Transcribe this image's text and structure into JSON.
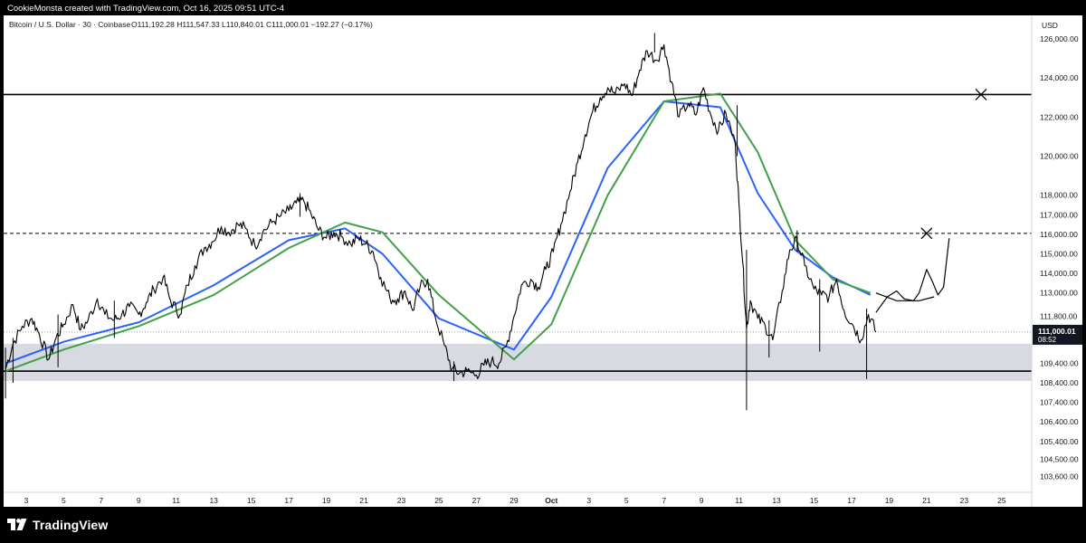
{
  "header": {
    "attribution": "CookieMonsta created with TradingView.com, Oct 16, 2025 09:51 UTC-4"
  },
  "footer": {
    "brand": "TradingView",
    "logo_icon": "tradingview-logo-icon"
  },
  "chart_data": {
    "type": "candlestick",
    "title": "Bitcoin / U.S. Dollar · 30 · Coinbase",
    "ohlc_text": "O111,192.28 H111,547.33 L110,840.01 C111,000.01 −192.27 (−0.17%)",
    "currency_label": "USD",
    "ylim": [
      102800,
      127200
    ],
    "y_axis_labels": [
      "126,000.00",
      "124,000.00",
      "122,000.00",
      "120,000.00",
      "118,000.00",
      "117,000.00",
      "116,000.00",
      "115,000.00",
      "114,000.00",
      "113,000.00",
      "111,800.00",
      "109,400.00",
      "108,400.00",
      "107,400.00",
      "106,400.00",
      "105,400.00",
      "104,500.00",
      "103,600.00"
    ],
    "y_axis_values": [
      126000,
      124000,
      122000,
      120000,
      118000,
      117000,
      116000,
      115000,
      114000,
      113000,
      111800,
      109400,
      108400,
      107400,
      106400,
      105400,
      104500,
      103600
    ],
    "x_axis_labels": [
      "3",
      "5",
      "7",
      "9",
      "11",
      "13",
      "15",
      "17",
      "19",
      "21",
      "23",
      "25",
      "27",
      "29",
      "Oct",
      "3",
      "5",
      "7",
      "9",
      "11",
      "13",
      "15",
      "17",
      "19",
      "21",
      "23",
      "25"
    ],
    "x_axis_days": [
      3,
      5,
      7,
      9,
      11,
      13,
      15,
      17,
      19,
      21,
      23,
      25,
      27,
      29,
      31,
      33,
      35,
      37,
      39,
      41,
      43,
      45,
      47,
      49,
      51,
      53,
      55
    ],
    "x_range_days": [
      1.8,
      56.6
    ],
    "price_line": {
      "value": 111000.01,
      "label": "111,000.01",
      "countdown": "08:52",
      "color": "#131722"
    },
    "price_path": [
      [
        1.9,
        109100
      ],
      [
        2.3,
        110400
      ],
      [
        2.8,
        111300
      ],
      [
        3.3,
        111700
      ],
      [
        3.7,
        110900
      ],
      [
        4.2,
        109600
      ],
      [
        4.6,
        110700
      ],
      [
        5.0,
        111400
      ],
      [
        5.5,
        112400
      ],
      [
        5.9,
        111100
      ],
      [
        6.3,
        111600
      ],
      [
        6.8,
        112700
      ],
      [
        7.2,
        111900
      ],
      [
        7.7,
        111600
      ],
      [
        8.1,
        111900
      ],
      [
        8.5,
        112300
      ],
      [
        9.0,
        111900
      ],
      [
        9.4,
        112500
      ],
      [
        9.8,
        113200
      ],
      [
        10.3,
        113800
      ],
      [
        10.7,
        112600
      ],
      [
        11.2,
        111900
      ],
      [
        11.6,
        113400
      ],
      [
        12.0,
        114400
      ],
      [
        12.5,
        115300
      ],
      [
        12.9,
        115600
      ],
      [
        13.4,
        116400
      ],
      [
        13.8,
        116100
      ],
      [
        14.3,
        116500
      ],
      [
        14.7,
        116300
      ],
      [
        15.2,
        115400
      ],
      [
        15.6,
        116100
      ],
      [
        16.1,
        116600
      ],
      [
        16.5,
        116900
      ],
      [
        17.0,
        117200
      ],
      [
        17.4,
        117600
      ],
      [
        17.8,
        117700
      ],
      [
        18.2,
        117000
      ],
      [
        18.6,
        116200
      ],
      [
        19.0,
        115800
      ],
      [
        19.4,
        116100
      ],
      [
        19.8,
        115900
      ],
      [
        20.3,
        115500
      ],
      [
        20.7,
        115800
      ],
      [
        21.1,
        115500
      ],
      [
        21.5,
        115100
      ],
      [
        21.9,
        113800
      ],
      [
        22.4,
        112700
      ],
      [
        22.8,
        112700
      ],
      [
        23.2,
        113100
      ],
      [
        23.6,
        112100
      ],
      [
        24.0,
        113300
      ],
      [
        24.4,
        113700
      ],
      [
        24.8,
        111800
      ],
      [
        25.3,
        110300
      ],
      [
        25.7,
        109100
      ],
      [
        26.1,
        108900
      ],
      [
        26.5,
        109000
      ],
      [
        27.0,
        108800
      ],
      [
        27.4,
        109300
      ],
      [
        27.8,
        109500
      ],
      [
        28.2,
        109400
      ],
      [
        28.6,
        110300
      ],
      [
        29.0,
        111800
      ],
      [
        29.4,
        113400
      ],
      [
        29.9,
        113700
      ],
      [
        30.3,
        113300
      ],
      [
        30.7,
        114200
      ],
      [
        31.1,
        115100
      ],
      [
        31.5,
        116500
      ],
      [
        32.0,
        118200
      ],
      [
        32.4,
        119700
      ],
      [
        32.8,
        121100
      ],
      [
        33.2,
        122300
      ],
      [
        33.6,
        123000
      ],
      [
        34.0,
        123500
      ],
      [
        34.4,
        123200
      ],
      [
        34.9,
        123700
      ],
      [
        35.3,
        123100
      ],
      [
        35.7,
        124400
      ],
      [
        36.1,
        125400
      ],
      [
        36.6,
        124900
      ],
      [
        37.0,
        125700
      ],
      [
        37.4,
        123800
      ],
      [
        37.8,
        122000
      ],
      [
        38.3,
        122700
      ],
      [
        38.7,
        122100
      ],
      [
        39.1,
        123500
      ],
      [
        39.5,
        122100
      ],
      [
        39.9,
        121300
      ],
      [
        40.3,
        122200
      ],
      [
        40.8,
        120600
      ],
      [
        41.0,
        117500
      ],
      [
        41.2,
        114500
      ],
      [
        41.4,
        111200
      ],
      [
        41.6,
        112600
      ],
      [
        42.0,
        111700
      ],
      [
        42.4,
        111300
      ],
      [
        42.8,
        110600
      ],
      [
        43.3,
        113100
      ],
      [
        43.7,
        115200
      ],
      [
        44.1,
        115700
      ],
      [
        44.5,
        114400
      ],
      [
        45.0,
        113200
      ],
      [
        45.4,
        112900
      ],
      [
        45.8,
        112800
      ],
      [
        46.2,
        113700
      ],
      [
        46.6,
        112100
      ],
      [
        47.1,
        111300
      ],
      [
        47.5,
        110600
      ],
      [
        47.9,
        111900
      ],
      [
        48.3,
        111000
      ]
    ],
    "wicks": [
      {
        "x": 1.9,
        "low": 107600,
        "high": 110200
      },
      {
        "x": 2.3,
        "low": 108400,
        "high": 110700
      },
      {
        "x": 4.7,
        "low": 109200,
        "high": 111900
      },
      {
        "x": 7.7,
        "low": 110700,
        "high": 112600
      },
      {
        "x": 17.6,
        "low": 116900,
        "high": 118100
      },
      {
        "x": 25.8,
        "low": 108500,
        "high": 109500
      },
      {
        "x": 36.5,
        "low": 125300,
        "high": 126300
      },
      {
        "x": 40.9,
        "low": 120000,
        "high": 122600
      },
      {
        "x": 41.4,
        "low": 107000,
        "high": 115200
      },
      {
        "x": 42.6,
        "low": 109700,
        "high": 111600
      },
      {
        "x": 44.1,
        "low": 115100,
        "high": 116200
      },
      {
        "x": 45.3,
        "low": 110000,
        "high": 113700
      },
      {
        "x": 47.8,
        "low": 108600,
        "high": 112200
      }
    ],
    "series": [
      {
        "name": "",
        "color": "#2962ff",
        "values": [
          [
            1.9,
            109400
          ],
          [
            5,
            110500
          ],
          [
            9,
            111500
          ],
          [
            13,
            113400
          ],
          [
            17,
            115700
          ],
          [
            20,
            116300
          ],
          [
            22,
            115000
          ],
          [
            25,
            111700
          ],
          [
            29,
            110100
          ],
          [
            31,
            112800
          ],
          [
            34,
            119400
          ],
          [
            37,
            122800
          ],
          [
            40,
            122500
          ],
          [
            42,
            118100
          ],
          [
            44,
            115200
          ],
          [
            46,
            113800
          ],
          [
            48,
            112900
          ]
        ]
      },
      {
        "name": "",
        "color": "#43a047",
        "values": [
          [
            1.9,
            109000
          ],
          [
            5,
            110100
          ],
          [
            9,
            111300
          ],
          [
            13,
            112900
          ],
          [
            17,
            115300
          ],
          [
            20,
            116600
          ],
          [
            22,
            116100
          ],
          [
            25,
            112900
          ],
          [
            29,
            109600
          ],
          [
            31,
            111400
          ],
          [
            34,
            118000
          ],
          [
            37,
            122800
          ],
          [
            40,
            123200
          ],
          [
            42,
            120200
          ],
          [
            44,
            115700
          ],
          [
            46,
            113700
          ],
          [
            48,
            113000
          ]
        ]
      }
    ],
    "horizontal_lines": [
      {
        "value": 123150,
        "style": "solid",
        "color": "#000000"
      },
      {
        "value": 116050,
        "style": "dashed",
        "color": "#000000"
      },
      {
        "value": 109000,
        "style": "solid",
        "color": "#000000"
      }
    ],
    "zone": {
      "low": 108500,
      "high": 110400,
      "color": "#d1d4dc"
    },
    "annotations": {
      "x_marks": [
        {
          "x": 53.9,
          "y": 123150
        },
        {
          "x": 51.0,
          "y": 116050
        }
      ],
      "projection": [
        [
          48.3,
          112000
        ],
        [
          48.9,
          112800
        ],
        [
          49.4,
          113100
        ],
        [
          49.8,
          112700
        ],
        [
          50.3,
          112600
        ],
        [
          50.6,
          113000
        ],
        [
          51.0,
          114200
        ],
        [
          51.3,
          113600
        ],
        [
          51.6,
          112900
        ],
        [
          51.9,
          113300
        ],
        [
          52.2,
          115800
        ]
      ],
      "arc": [
        [
          48.3,
          113000
        ],
        [
          49.4,
          112600
        ],
        [
          50.6,
          112600
        ],
        [
          51.4,
          112800
        ]
      ]
    },
    "grid": false,
    "legend": "none"
  }
}
